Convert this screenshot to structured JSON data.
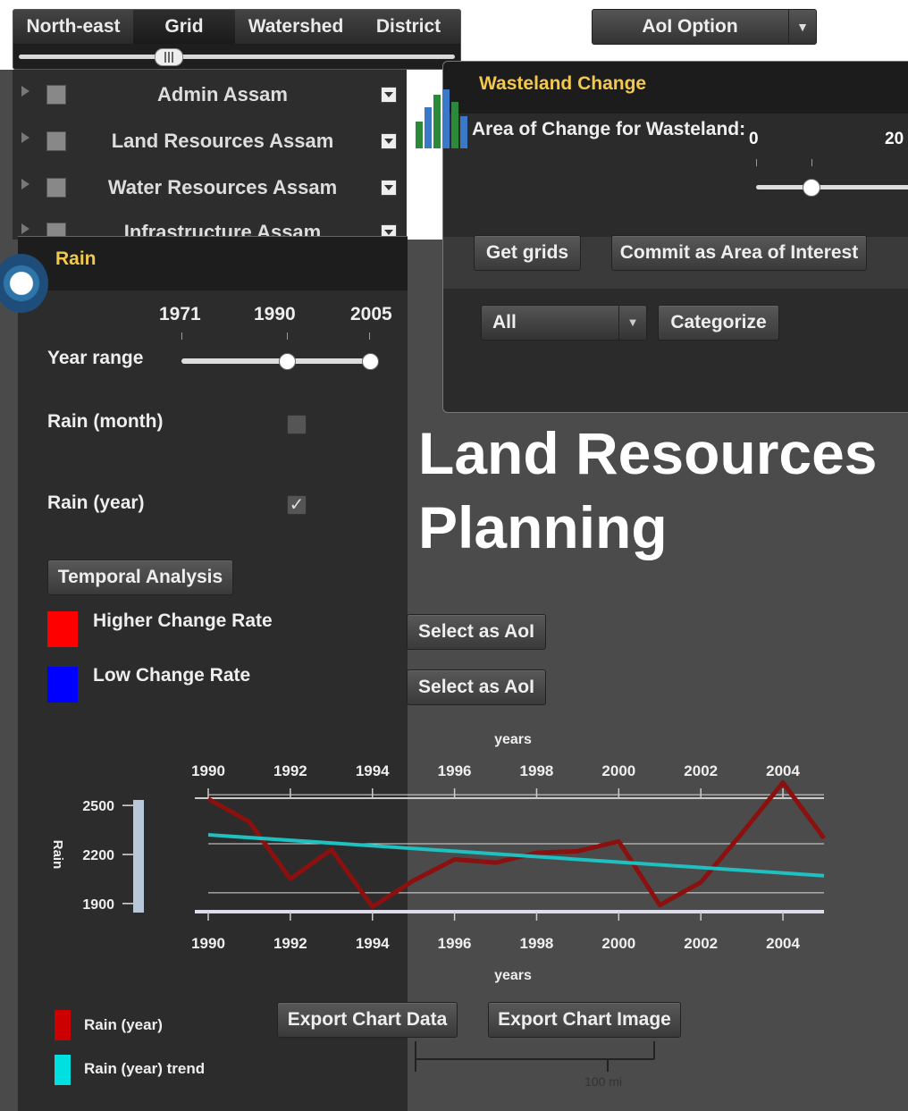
{
  "tabs": [
    "North-east",
    "Grid",
    "Watershed",
    "District"
  ],
  "aoi_option": {
    "label": "AoI Option"
  },
  "layers": [
    {
      "name": "Admin Assam"
    },
    {
      "name": "Land Resources Assam"
    },
    {
      "name": "Water Resources Assam"
    },
    {
      "name": "Infrastructure Assam"
    }
  ],
  "wasteland": {
    "title": "Wasteland Change",
    "area_label": "Area of Change for Wasteland:",
    "slider_min_label": "0",
    "slider_max_label": "20",
    "get_grids": "Get grids",
    "commit": "Commit as Area of Interest",
    "select_value": "All",
    "categorize": "Categorize"
  },
  "rain": {
    "title": "Rain",
    "year_ticks": [
      "1971",
      "1990",
      "2005"
    ],
    "year_range_label": "Year range",
    "year_range": [
      1990,
      2005
    ],
    "rain_month_label": "Rain (month)",
    "rain_month_checked": false,
    "rain_year_label": "Rain (year)",
    "rain_year_checked": true,
    "temporal_button": "Temporal Analysis",
    "higher_label": "Higher Change Rate",
    "low_label": "Low Change Rate",
    "higher_color": "#ff0000",
    "low_color": "#0000ff",
    "select_aoi": "Select as AoI",
    "export_data": "Export Chart Data",
    "export_image": "Export Chart Image"
  },
  "headline": {
    "line1": "Land Resources",
    "line2": "Planning"
  },
  "scale_label": "100 mi",
  "chart_data": {
    "type": "line",
    "xlabel": "years",
    "ylabel": "Rain",
    "x_ticks": [
      "1990",
      "1992",
      "1994",
      "1996",
      "1998",
      "2000",
      "2002",
      "2004"
    ],
    "y_ticks": [
      "2500",
      "2200",
      "1900"
    ],
    "xlim": [
      1990,
      2005
    ],
    "ylim": [
      1850,
      2600
    ],
    "series": [
      {
        "name": "Rain (year)",
        "color": "#8b1010",
        "x": [
          1990,
          1991,
          1992,
          1993,
          1994,
          1995,
          1996,
          1997,
          1998,
          1999,
          2000,
          2001,
          2002,
          2003,
          2004,
          2005
        ],
        "y": [
          2540,
          2400,
          2050,
          2230,
          1880,
          2040,
          2170,
          2150,
          2210,
          2220,
          2280,
          1890,
          2030,
          2330,
          2640,
          2300
        ]
      },
      {
        "name": "Rain (year) trend",
        "color": "#1fc0c0",
        "x": [
          1990,
          2005
        ],
        "y": [
          2320,
          2070
        ]
      }
    ]
  }
}
